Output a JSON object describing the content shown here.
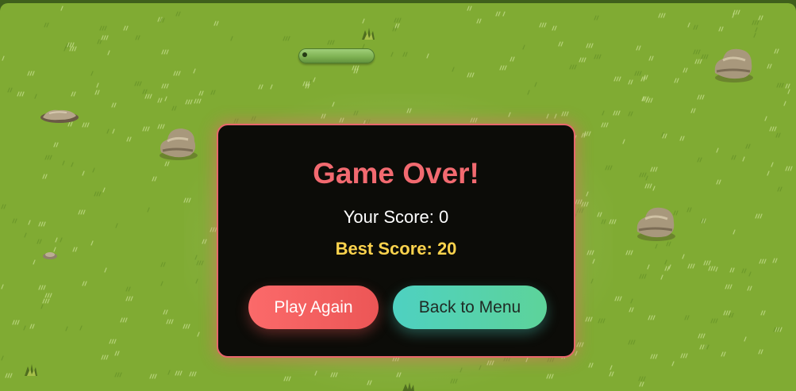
{
  "game_over": {
    "title": "Game Over!",
    "score_text": "Your Score: 0",
    "best_text": "Best Score: 20",
    "play_again_label": "Play Again",
    "menu_label": "Back to Menu"
  },
  "colors": {
    "field": "#80ab33",
    "modal_bg": "#0c0c08",
    "modal_border": "#e8676b",
    "title": "#f26a70",
    "best": "#fcd34d",
    "play_button": "#f25f5f",
    "menu_button": "#52d2b0"
  },
  "scene": {
    "icons": [
      "snake-icon",
      "rock-icon",
      "bush-icon",
      "grass-tuft-icon"
    ]
  }
}
